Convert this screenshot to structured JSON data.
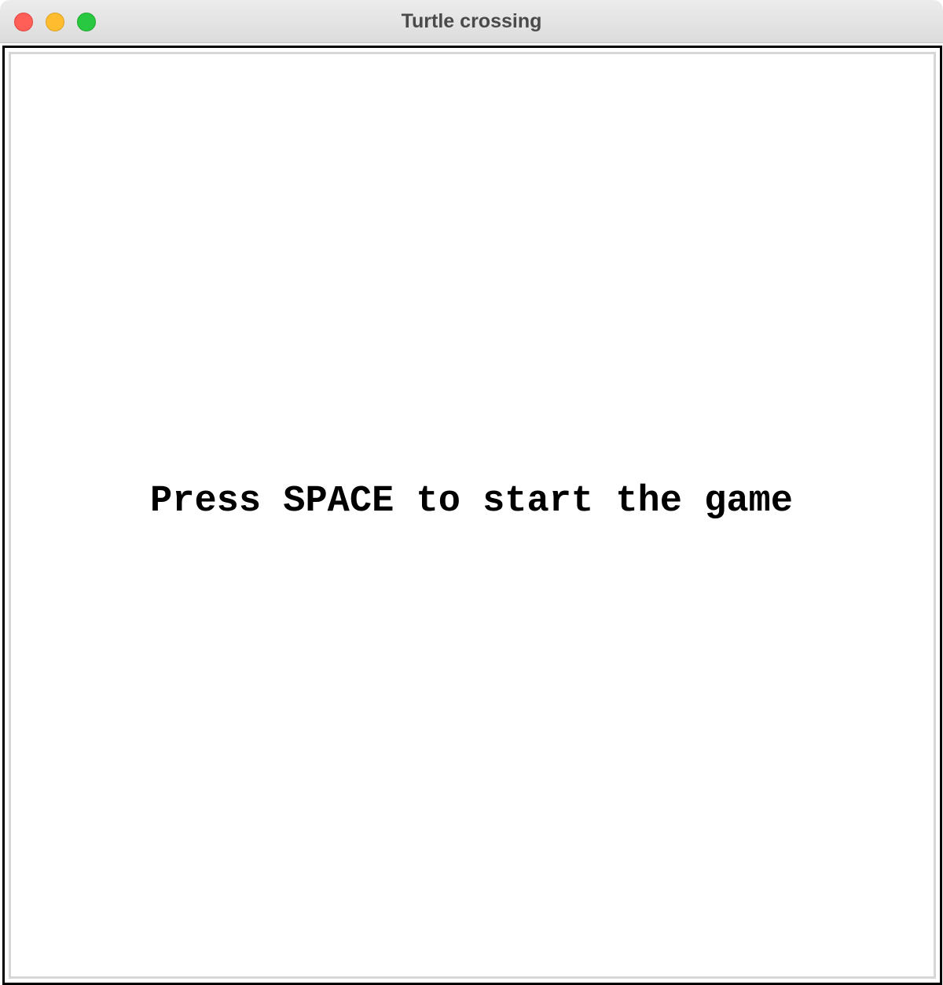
{
  "window": {
    "title": "Turtle crossing",
    "controls": {
      "close_color": "#ff5f57",
      "minimize_color": "#febc2e",
      "zoom_color": "#28c840"
    }
  },
  "game": {
    "message": "Press SPACE to start the game",
    "background_color": "#ffffff",
    "text_color": "#000000"
  }
}
